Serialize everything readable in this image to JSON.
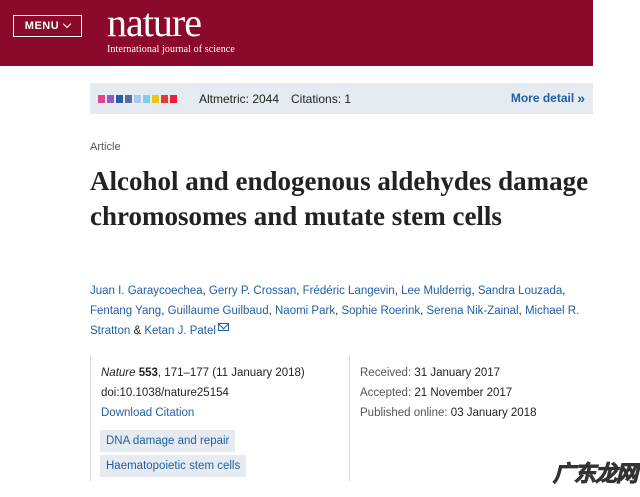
{
  "header": {
    "menu_label": "MENU",
    "logo_word": "nature",
    "logo_tagline": "International journal of science",
    "background_color": "#8b0a2b"
  },
  "metrics": {
    "altmetric": "Altmetric: 2044",
    "citations": "Citations: 1",
    "more_detail": "More detail",
    "donut_colors": [
      "#e0468f",
      "#8f5fc0",
      "#2a5fa8",
      "#5b6b9a",
      "#a8c9e8",
      "#7ecfe0",
      "#f0c420",
      "#e83a2f",
      "#e8203a"
    ]
  },
  "article": {
    "type": "Article",
    "title": "Alcohol and endogenous aldehydes damage chromosomes and mutate stem cells",
    "authors": [
      "Juan I. Garaycoechea",
      "Gerry P. Crossan",
      "Frédéric Langevin",
      "Lee Mulderrig",
      "Sandra Louzada",
      "Fentang Yang",
      "Guillaume Guilbaud",
      "Naomi Park",
      "Sophie Roerink",
      "Serena Nik-Zainal",
      "Michael R. Stratton",
      "Ketan J. Patel"
    ],
    "authors_separator": ",",
    "authors_ampersand": "&"
  },
  "citation": {
    "journal": "Nature",
    "volume": "553",
    "pages_date": ", 171–177 (11 January 2018)",
    "doi": "doi:10.1038/nature25154",
    "download": "Download Citation",
    "subjects": [
      "DNA damage and repair",
      "Haematopoietic stem cells"
    ]
  },
  "dates": {
    "received_label": "Received:",
    "received": "31 January 2017",
    "accepted_label": "Accepted:",
    "accepted": "21 November 2017",
    "published_label": "Published online:",
    "published": "03 January 2018"
  },
  "watermark": {
    "text": "广东龙网"
  }
}
